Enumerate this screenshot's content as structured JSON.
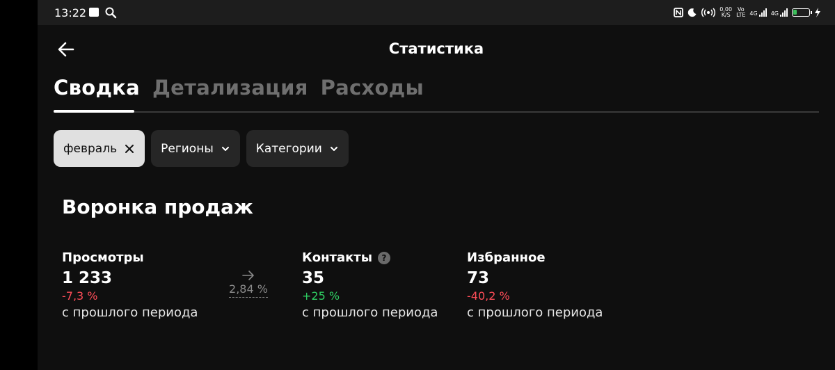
{
  "status_bar": {
    "time": "13:22",
    "net_speed_top": "0,00",
    "net_speed_bottom": "K/S",
    "volte_top": "Vo",
    "volte_bottom": "LTE",
    "signal1_label": "4G",
    "signal2_label": "4G",
    "battery_color": "#3cc05b"
  },
  "header": {
    "title": "Статистика",
    "back_icon": "arrow-left-icon"
  },
  "tabs": [
    {
      "label": "Сводка",
      "active": true
    },
    {
      "label": "Детализация",
      "active": false
    },
    {
      "label": "Расходы",
      "active": false
    }
  ],
  "filters": [
    {
      "label": "февраль",
      "selected": true,
      "icon": "close-icon"
    },
    {
      "label": "Регионы",
      "selected": false,
      "icon": "chevron-down-icon"
    },
    {
      "label": "Категории",
      "selected": false,
      "icon": "chevron-down-icon"
    }
  ],
  "funnel": {
    "title": "Воронка продаж",
    "conversion": "2,84 %",
    "metrics": [
      {
        "label": "Просмотры",
        "value": "1 233",
        "change": "-7,3 %",
        "change_type": "negative",
        "period": "с прошлого периода"
      },
      {
        "label": "Контакты",
        "value": "35",
        "change": "+25 %",
        "change_type": "positive",
        "period": "с прошлого периода",
        "help_icon": "?"
      },
      {
        "label": "Избранное",
        "value": "73",
        "change": "-40,2 %",
        "change_type": "negative",
        "period": "с прошлого периода"
      }
    ]
  },
  "colors": {
    "background": "#0f0f0f",
    "negative": "#ff4d58",
    "positive": "#2fcf63",
    "chip": "#262626",
    "chip_selected": "#e0e0e0"
  }
}
